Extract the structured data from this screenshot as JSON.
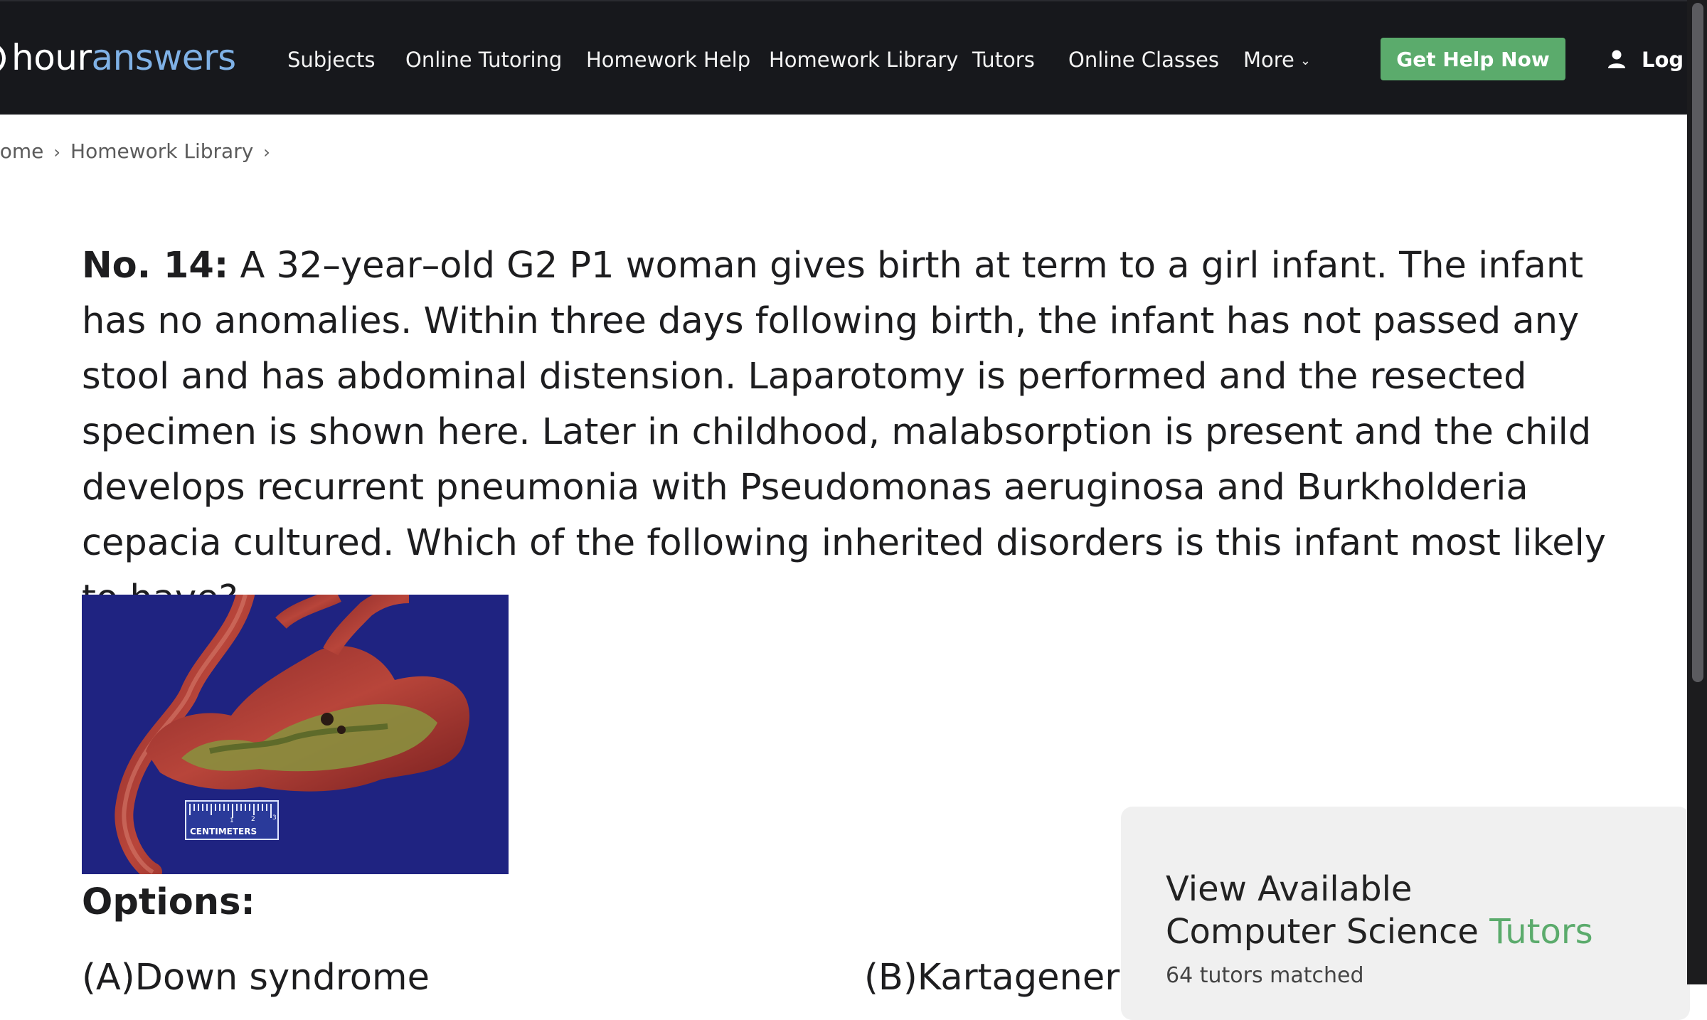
{
  "navbar": {
    "logo": {
      "part1": "hour",
      "part2": "answers"
    },
    "items": [
      {
        "label": "Subjects"
      },
      {
        "label": "Online Tutoring"
      },
      {
        "label": "Homework Help"
      },
      {
        "label": "Homework Library"
      },
      {
        "label": "Tutors"
      },
      {
        "label": "Online Classes"
      },
      {
        "label": "More"
      }
    ],
    "cta": "Get Help Now",
    "login": "Log I"
  },
  "breadcrumb": {
    "items": [
      "lome",
      "Homework Library"
    ]
  },
  "question": {
    "number": "No. 14:",
    "text": "A 32–year–old G2 P1 woman gives birth at term to a girl infant. The infant has no anomalies. Within three days following birth, the infant has not passed any stool and has abdominal distension. Laparotomy is performed and the resected specimen is shown here. Later in childhood, malabsorption is present and the child develops recurrent pneumonia with Pseudomonas aeruginosa and Burkholderia cepacia cultured. Which of the following inherited disorders is this infant most likely to have?"
  },
  "figure": {
    "ruler_label": "CENTIMETERS",
    "ruler_numbers": [
      "1",
      "2",
      "3"
    ]
  },
  "options": {
    "title": "Options:",
    "items": [
      {
        "label": "(A)Down syndrome"
      },
      {
        "label": "(B)Kartagener syndrome"
      }
    ]
  },
  "tutor_card": {
    "title_line1": "View Available",
    "title_line2": "Computer Science",
    "title_accent": "Tutors",
    "subtitle": "64 tutors matched"
  },
  "colors": {
    "nav_bg": "#17181c",
    "accent_green": "#5bab6c",
    "logo_blue": "#7fb1e6"
  }
}
